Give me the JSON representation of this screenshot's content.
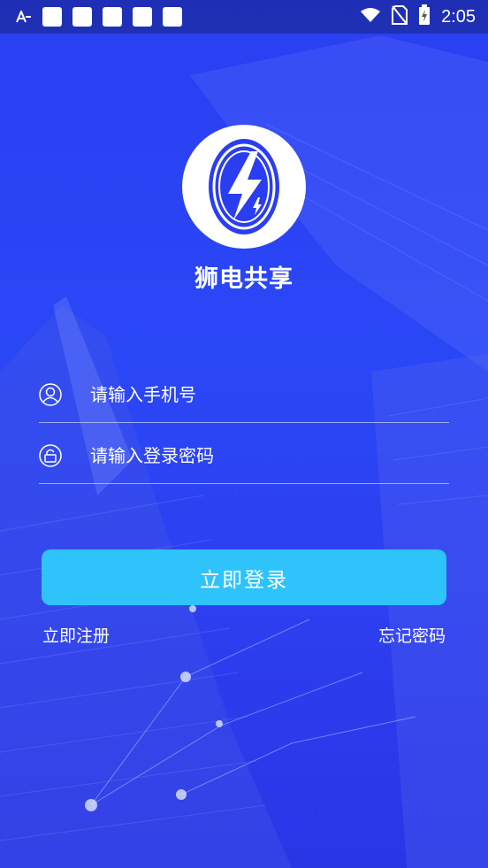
{
  "status_bar": {
    "time": "2:05"
  },
  "app": {
    "name": "狮电共享"
  },
  "form": {
    "phone_placeholder": "请输入手机号",
    "password_placeholder": "请输入登录密码",
    "login_label": "立即登录",
    "register_label": "立即注册",
    "forgot_label": "忘记密码"
  },
  "colors": {
    "background": "#2a44f4",
    "button": "#2ec4fb"
  }
}
